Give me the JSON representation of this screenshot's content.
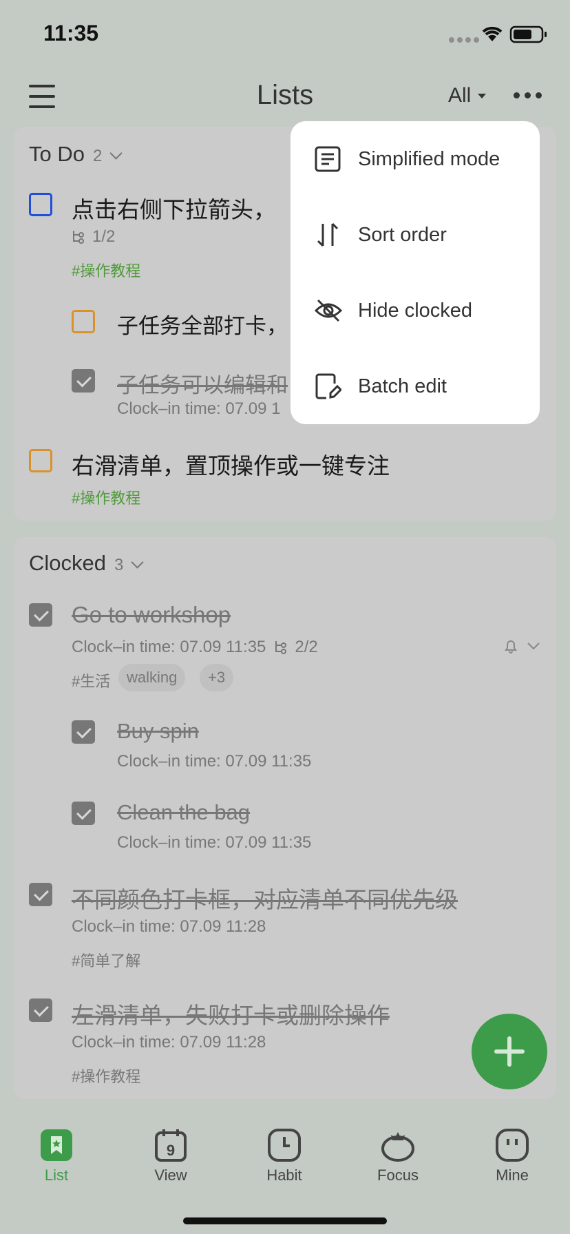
{
  "status": {
    "time": "11:35"
  },
  "header": {
    "title": "Lists",
    "filter_label": "All"
  },
  "todo_section": {
    "title": "To Do",
    "count": "2",
    "tasks": [
      {
        "title": "点击右侧下拉箭头，",
        "subtask_progress": "1/2",
        "tag": "#操作教程",
        "checkbox_color": "#1e4fd6"
      },
      {
        "title": "子任务全部打卡，"
      },
      {
        "title": "子任务可以编辑和",
        "clockin": "Clock–in time: 07.09 1"
      },
      {
        "title": "右滑清单，置顶操作或一键专注",
        "tag": "#操作教程",
        "checkbox_color": "#d9922b"
      }
    ]
  },
  "clocked_section": {
    "title": "Clocked",
    "count": "3",
    "tasks": [
      {
        "title": "Go to workshop",
        "clockin": "Clock–in time: 07.09 11:35",
        "subtask_progress": "2/2",
        "tag": "#生活",
        "pills": [
          "walking",
          "+3"
        ]
      },
      {
        "title": "Buy spin",
        "clockin": "Clock–in time: 07.09 11:35"
      },
      {
        "title": "Clean the bag",
        "clockin": "Clock–in time: 07.09 11:35"
      },
      {
        "title": "不同颜色打卡框，对应清单不同优先级",
        "clockin": "Clock–in time: 07.09 11:28",
        "tag": "#简单了解"
      },
      {
        "title": "左滑清单，失败打卡或删除操作",
        "clockin": "Clock–in time: 07.09 11:28",
        "tag": "#操作教程"
      }
    ]
  },
  "dropdown_menu": {
    "items": [
      {
        "label": "Simplified mode",
        "icon": "document-icon"
      },
      {
        "label": "Sort order",
        "icon": "sort-arrows-icon"
      },
      {
        "label": "Hide clocked",
        "icon": "eye-off-icon"
      },
      {
        "label": "Batch edit",
        "icon": "edit-document-icon"
      }
    ]
  },
  "tabbar": {
    "tabs": [
      {
        "label": "List",
        "icon": "list-icon"
      },
      {
        "label": "View",
        "icon": "calendar-icon",
        "badge": "9"
      },
      {
        "label": "Habit",
        "icon": "clock-icon"
      },
      {
        "label": "Focus",
        "icon": "tomato-icon"
      },
      {
        "label": "Mine",
        "icon": "face-icon"
      }
    ]
  },
  "colors": {
    "accent": "#3d9c49",
    "tag_green": "#4f9a3a",
    "priority_blue": "#1e4fd6",
    "priority_orange": "#d9922b"
  }
}
